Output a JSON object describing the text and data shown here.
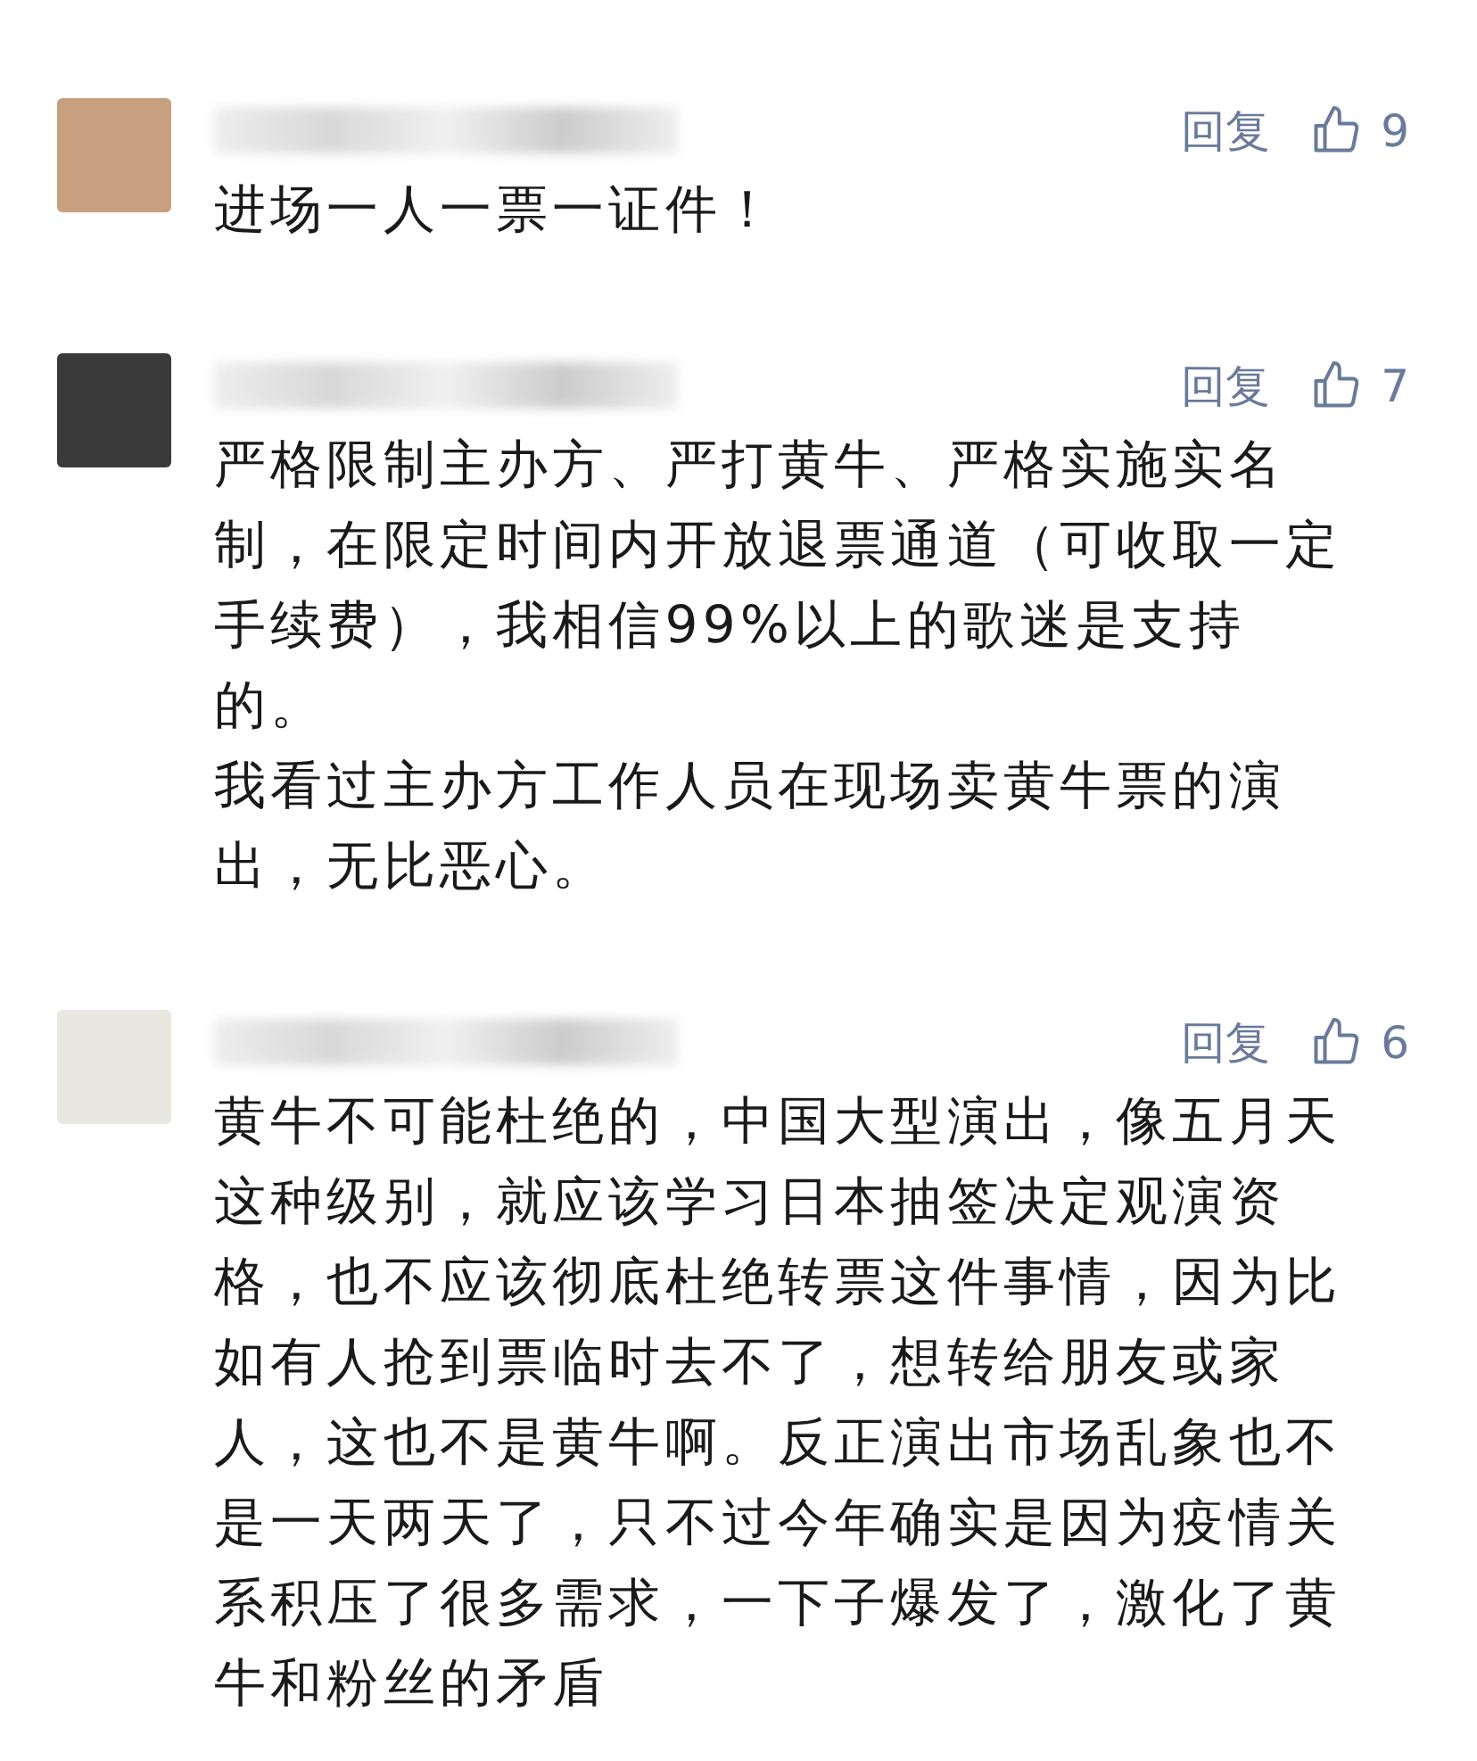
{
  "comments": [
    {
      "reply_label": "回复",
      "likes": "9",
      "paragraphs": [
        "进场一人一票一证件！"
      ]
    },
    {
      "reply_label": "回复",
      "likes": "7",
      "paragraphs": [
        "严格限制主办方、严打黄牛、严格实施实名制，在限定时间内开放退票通道（可收取一定手续费），我相信99%以上的歌迷是支持的。",
        "我看过主办方工作人员在现场卖黄牛票的演出，无比恶心。"
      ]
    },
    {
      "reply_label": "回复",
      "likes": "6",
      "paragraphs": [
        "黄牛不可能杜绝的，中国大型演出，像五月天这种级别，就应该学习日本抽签决定观演资格，也不应该彻底杜绝转票这件事情，因为比如有人抢到票临时去不了，想转给朋友或家人，这也不是黄牛啊。反正演出市场乱象也不是一天两天了，只不过今年确实是因为疫情关系积压了很多需求，一下子爆发了，激化了黄牛和粉丝的矛盾"
      ]
    }
  ]
}
